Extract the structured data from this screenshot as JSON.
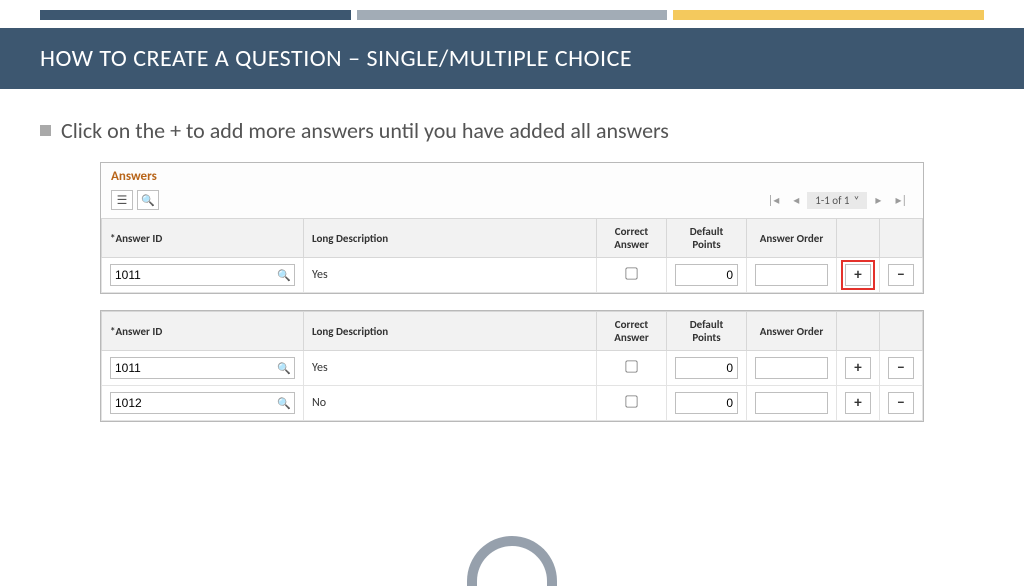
{
  "colors": {
    "band": "#3d5770",
    "accent_grey": "#a2acb6",
    "accent_gold": "#f4c95d",
    "section_title": "#b8651a",
    "highlight": "#e4312b"
  },
  "title": "HOW TO CREATE A QUESTION – SINGLE/MULTIPLE CHOICE",
  "bullet": "Click on the + to add more answers until you have added all answers",
  "answers_panel": {
    "heading": "Answers",
    "pager": {
      "text": "1-1 of 1"
    },
    "columns": {
      "id": "*Answer ID",
      "desc": "Long Description",
      "correct": "Correct Answer",
      "points": "Default Points",
      "order": "Answer Order"
    },
    "rows": [
      {
        "id": "1011",
        "desc": "Yes",
        "correct": false,
        "points": "0",
        "order": ""
      }
    ]
  },
  "answers_panel2": {
    "columns": {
      "id": "*Answer ID",
      "desc": "Long Description",
      "correct": "Correct Answer",
      "points": "Default Points",
      "order": "Answer Order"
    },
    "rows": [
      {
        "id": "1011",
        "desc": "Yes",
        "correct": false,
        "points": "0",
        "order": ""
      },
      {
        "id": "1012",
        "desc": "No",
        "correct": false,
        "points": "0",
        "order": ""
      }
    ]
  },
  "glyphs": {
    "plus": "+",
    "minus": "−",
    "chevdown": "˅",
    "list": "☰"
  }
}
